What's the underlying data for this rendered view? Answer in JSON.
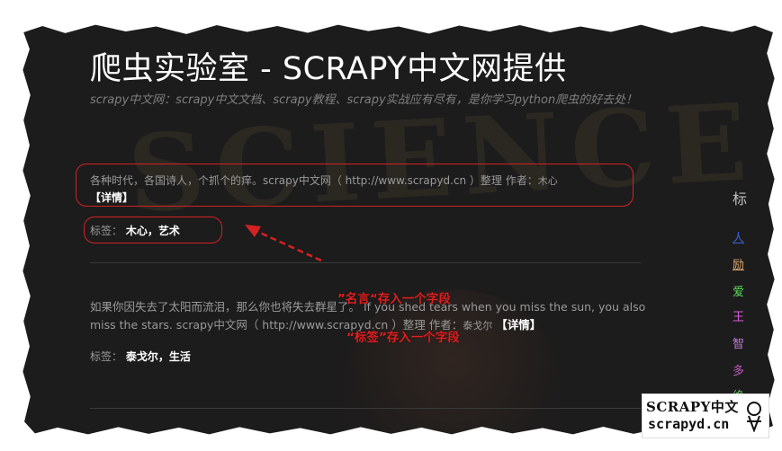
{
  "page": {
    "title": "爬虫实验室 - SCRAPY中文网提供",
    "subtitle": "scrapy中文网：scrapy中文文档、scrapy教程、scrapy实战应有尽有，是你学习python爬虫的好去处！"
  },
  "quotes": [
    {
      "text": "各种时代，各国诗人，个抓个的痒。scrapy中文网（ http://www.scrapyd.cn ）整理 作者：",
      "author": "木心",
      "detail_label": "【详情】",
      "tags_label": "标签：",
      "tags": [
        "木心",
        "艺术"
      ]
    },
    {
      "text": "如果你因失去了太阳而流泪，那么你也将失去群星了。 If you shed tears when you miss the sun, you also miss the stars. scrapy中文网（ http://www.scrapyd.cn ）整理 作者：",
      "author": "泰戈尔",
      "detail_label": "【详情】",
      "tags_label": "标签：",
      "tags": [
        "泰戈尔",
        "生活"
      ]
    }
  ],
  "annotations": {
    "quote_field": "”名言“存入一个字段",
    "tag_field": "“标签”存入一个字段"
  },
  "sidebar": {
    "heading": "标",
    "tags": [
      {
        "label": "人",
        "color": "#3c63d8"
      },
      {
        "label": "励",
        "color": "#e0a56a"
      },
      {
        "label": "爱",
        "color": "#5ad45a"
      },
      {
        "label": "王",
        "color": "#d85ad8"
      },
      {
        "label": "智",
        "color": "#c07ad8"
      },
      {
        "label": "多",
        "color": "#c05ac0"
      },
      {
        "label": "绝",
        "color": "#5ac05a"
      }
    ]
  },
  "logo": {
    "top_text": "SCRAPY中文",
    "bottom_text": "scrapyd.cn"
  },
  "colors": {
    "background": "#1c1c1c",
    "highlight": "#d42121",
    "text_muted": "#9a9a9a"
  }
}
